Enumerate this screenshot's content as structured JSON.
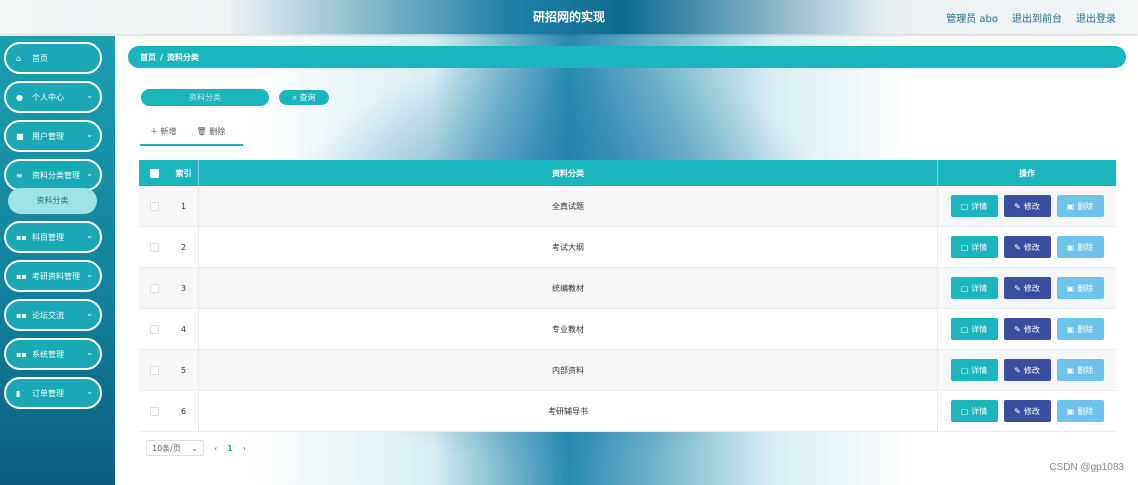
{
  "header": {
    "title": "研招网的实现",
    "admin": "管理员 abo",
    "exit_front": "退出到前台",
    "logout": "退出登录"
  },
  "sidebar": {
    "items": [
      {
        "label": "首页",
        "icon": "home-icon"
      },
      {
        "label": "个人中心",
        "icon": "user-icon"
      },
      {
        "label": "用户管理",
        "icon": "message-icon"
      },
      {
        "label": "资料分类管理",
        "icon": "list-icon"
      },
      {
        "label": "科目管理",
        "icon": "grid-icon"
      },
      {
        "label": "考研资料管理",
        "icon": "grid-icon"
      },
      {
        "label": "论坛交流",
        "icon": "grid-icon"
      },
      {
        "label": "系统管理",
        "icon": "grid-icon"
      },
      {
        "label": "订单管理",
        "icon": "bag-icon"
      }
    ],
    "sub_item": "资料分类"
  },
  "breadcrumb": {
    "home": "首页",
    "sep": "/",
    "current": "资料分类"
  },
  "search": {
    "placeholder": "资料分类",
    "button": "查询"
  },
  "toolbar": {
    "add": "新增",
    "delete": "删除"
  },
  "table": {
    "headers": {
      "index": "索引",
      "name": "资料分类",
      "ops": "操作"
    },
    "rows": [
      {
        "index": "1",
        "name": "全真试题"
      },
      {
        "index": "2",
        "name": "考试大纲"
      },
      {
        "index": "3",
        "name": "统编教材"
      },
      {
        "index": "4",
        "name": "专业教材"
      },
      {
        "index": "5",
        "name": "内部资料"
      },
      {
        "index": "6",
        "name": "考研辅导书"
      }
    ],
    "actions": {
      "detail": "详情",
      "edit": "修改",
      "delete": "删除"
    }
  },
  "pagination": {
    "page_size": "10条/页",
    "current_page": "1"
  },
  "watermark": "CSDN @gp1083",
  "colors": {
    "accent": "#1ab5bd",
    "edit": "#3a4ea0",
    "delete": "#6ec3ec"
  }
}
